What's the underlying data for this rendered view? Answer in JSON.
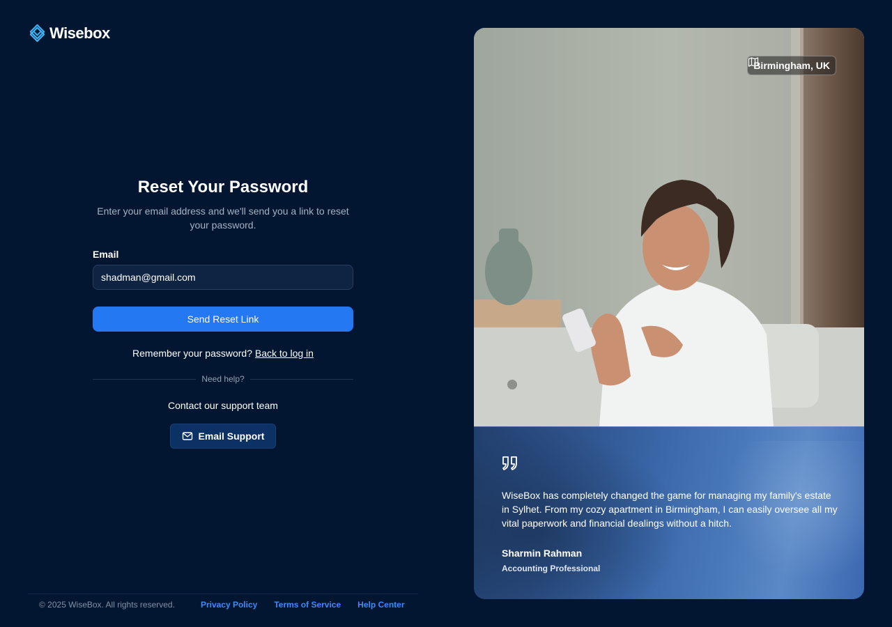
{
  "brand": {
    "name": "Wisebox"
  },
  "form": {
    "title": "Reset Your Password",
    "subtitle": "Enter your email address and we'll send you a link to reset your password.",
    "email_label": "Email",
    "email_value": "shadman@gmail.com",
    "submit_label": "Send Reset Link",
    "remember_text": "Remember your password?",
    "back_link": "Back to log in",
    "divider_text": "Need help?",
    "contact_text": "Contact our support team",
    "support_button": "Email Support"
  },
  "footer": {
    "copyright": "© 2025 WiseBox. All rights reserved.",
    "links": [
      "Privacy Policy",
      "Terms of Service",
      "Help Center"
    ]
  },
  "testimonial": {
    "location": "Birmingham, UK",
    "quote": "WiseBox has completely changed the game for managing my family's estate in Sylhet. From my cozy apartment in Birmingham, I can easily oversee all my vital paperwork and financial dealings without a hitch.",
    "author": "Sharmin Rahman",
    "role": "Accounting Professional"
  },
  "colors": {
    "background": "#021631",
    "primary": "#2478f2",
    "link": "#3f8af5",
    "support_button": "#0c3165"
  },
  "icons": [
    "wisebox-logo-icon",
    "mail-icon",
    "map-icon",
    "quote-icon"
  ]
}
